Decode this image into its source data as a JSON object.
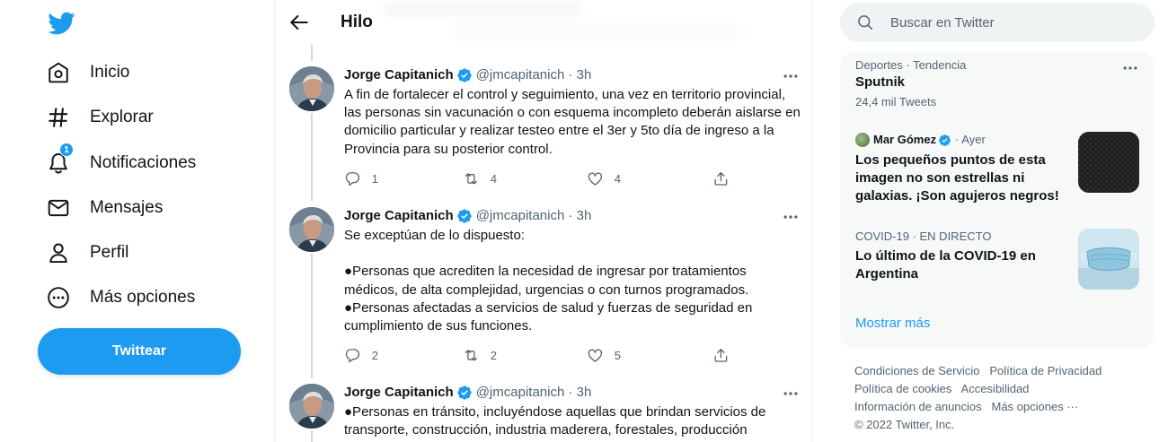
{
  "nav": {
    "items": [
      {
        "label": "Inicio",
        "icon": "home-icon"
      },
      {
        "label": "Explorar",
        "icon": "hashtag-icon"
      },
      {
        "label": "Notificaciones",
        "icon": "bell-icon",
        "badge": "1"
      },
      {
        "label": "Mensajes",
        "icon": "mail-icon"
      },
      {
        "label": "Perfil",
        "icon": "person-icon"
      },
      {
        "label": "Más opciones",
        "icon": "more-circle-icon"
      }
    ],
    "tweet_button": "Twittear"
  },
  "header": {
    "title": "Hilo"
  },
  "tweets": [
    {
      "name": "Jorge Capitanich",
      "handle": "@jmcapitanich",
      "time": "3h",
      "text": "A fin de fortalecer el control y seguimiento, una vez en territorio provincial, las personas sin vacunación o con esquema incompleto deberán aislarse en domicilio particular y realizar testeo entre el 3er y 5to día de ingreso a la Provincia para su posterior control.",
      "replies": "1",
      "retweets": "4",
      "likes": "4"
    },
    {
      "name": "Jorge Capitanich",
      "handle": "@jmcapitanich",
      "time": "3h",
      "text": "Se exceptúan de lo dispuesto:\n\n●Personas que acrediten la necesidad de ingresar por tratamientos médicos, de alta complejidad, urgencias o con turnos programados.\n●Personas afectadas a servicios de salud y fuerzas de seguridad en cumplimiento de sus funciones.",
      "replies": "2",
      "retweets": "2",
      "likes": "5"
    },
    {
      "name": "Jorge Capitanich",
      "handle": "@jmcapitanich",
      "time": "3h",
      "text": "●Personas en tránsito, incluyéndose aquellas que brindan servicios de transporte, construcción, industria maderera, forestales, producción",
      "replies": "",
      "retweets": "",
      "likes": ""
    }
  ],
  "search": {
    "placeholder": "Buscar en Twitter"
  },
  "trends": [
    {
      "meta": "Deportes · Tendencia",
      "title": "Sputnik",
      "count": "24,4 mil Tweets"
    },
    {
      "author": "Mar Gómez",
      "time": "· Ayer",
      "title": "Los pequeños puntos de esta imagen no son estrellas ni galaxias. ¡Son agujeros negros!"
    },
    {
      "meta": "COVID-19 · EN DIRECTO",
      "title": "Lo último de la COVID-19 en Argentina"
    }
  ],
  "show_more": "Mostrar más",
  "footer": {
    "links": [
      "Condiciones de Servicio",
      "Política de Privacidad",
      "Política de cookies",
      "Accesibilidad",
      "Información de anuncios",
      "Más opciones ···"
    ],
    "copyright": "© 2022 Twitter, Inc."
  },
  "colors": {
    "accent": "#1d9bf0",
    "text": "#0f1419",
    "secondary": "#536471"
  }
}
